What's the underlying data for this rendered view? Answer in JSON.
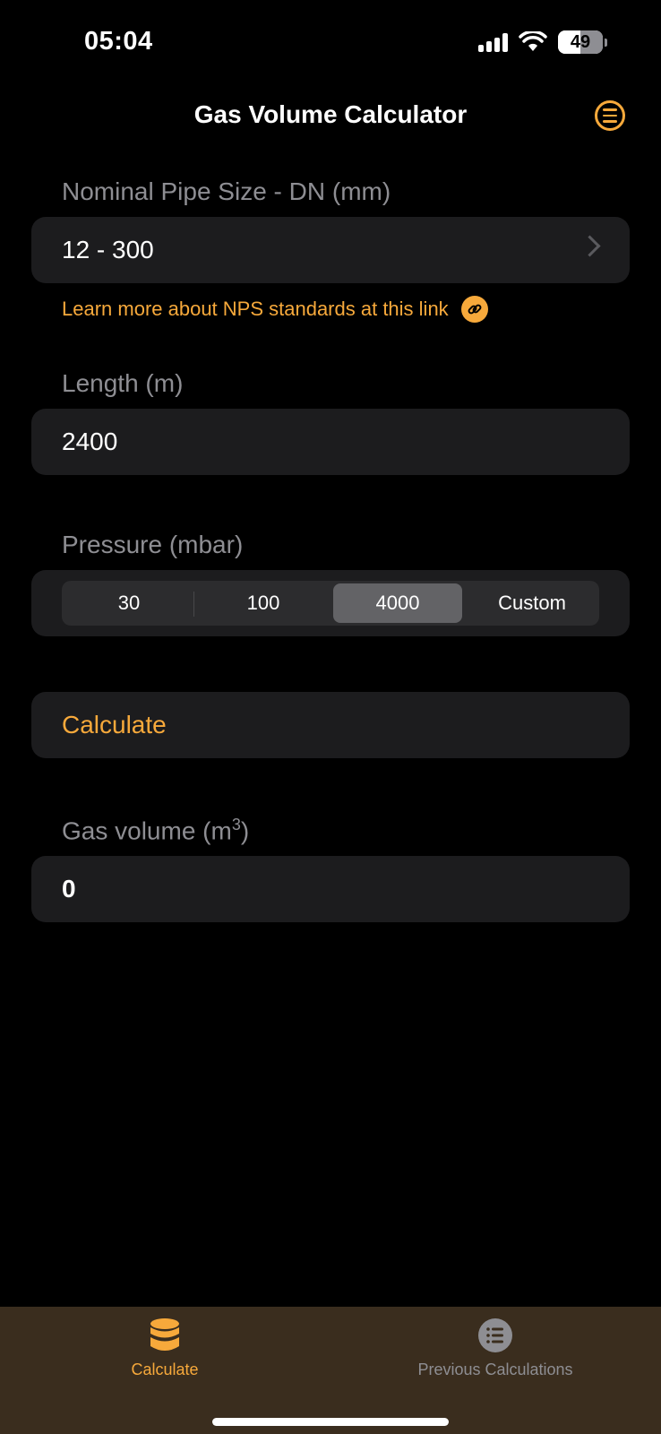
{
  "status_bar": {
    "time": "05:04",
    "battery": "49"
  },
  "nav": {
    "title": "Gas Volume Calculator",
    "menu_icon": "list-circle-icon"
  },
  "pipe_size": {
    "label": "Nominal Pipe Size - DN (mm)",
    "value": "12 - 300",
    "link_text": "Learn more about NPS standards at this link"
  },
  "length": {
    "label": "Length (m)",
    "value": "2400"
  },
  "pressure": {
    "label": "Pressure (mbar)",
    "options": [
      "30",
      "100",
      "4000",
      "Custom"
    ],
    "selected": "4000"
  },
  "calculate": {
    "label": "Calculate"
  },
  "result": {
    "label_prefix": "Gas volume (m",
    "label_sup": "3",
    "label_suffix": ")",
    "value": "0"
  },
  "tabbar": {
    "tabs": [
      {
        "label": "Calculate",
        "icon": "cylinder-icon",
        "active": true
      },
      {
        "label": "Previous Calculations",
        "icon": "list-icon",
        "active": false
      }
    ]
  },
  "colors": {
    "accent": "#f7a93b",
    "background": "#000000",
    "field": "#1c1c1e",
    "tabbar": "#3a2d1e"
  }
}
